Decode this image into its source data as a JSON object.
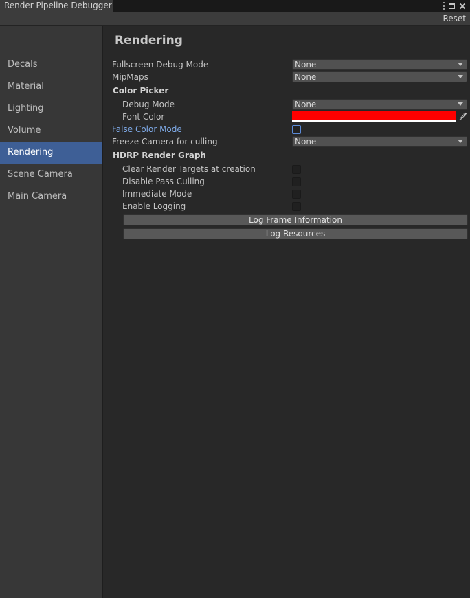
{
  "window": {
    "tab_title": "Render Pipeline Debugger"
  },
  "toolbar": {
    "reset_label": "Reset"
  },
  "sidebar": {
    "items": [
      {
        "label": "Decals",
        "active": false
      },
      {
        "label": "Material",
        "active": false
      },
      {
        "label": "Lighting",
        "active": false
      },
      {
        "label": "Volume",
        "active": false
      },
      {
        "label": "Rendering",
        "active": true
      },
      {
        "label": "Scene Camera",
        "active": false
      },
      {
        "label": "Main Camera",
        "active": false
      }
    ]
  },
  "panel": {
    "title": "Rendering",
    "fullscreen_debug_mode": {
      "label": "Fullscreen Debug Mode",
      "value": "None"
    },
    "mipmaps": {
      "label": "MipMaps",
      "value": "None"
    },
    "color_picker": {
      "header": "Color Picker",
      "debug_mode": {
        "label": "Debug Mode",
        "value": "None"
      },
      "font_color": {
        "label": "Font Color",
        "color": "#ff0000"
      }
    },
    "false_color_mode": {
      "label": "False Color Mode",
      "checked": false
    },
    "freeze_camera": {
      "label": "Freeze Camera for culling",
      "value": "None"
    },
    "render_graph": {
      "header": "HDRP Render Graph",
      "clear_render_targets": {
        "label": "Clear Render Targets at creation",
        "checked": false
      },
      "disable_pass_culling": {
        "label": "Disable Pass Culling",
        "checked": false
      },
      "immediate_mode": {
        "label": "Immediate Mode",
        "checked": false
      },
      "enable_logging": {
        "label": "Enable Logging",
        "checked": false
      },
      "log_frame_info_label": "Log Frame Information",
      "log_resources_label": "Log Resources"
    }
  },
  "colors": {
    "accent": "#3e5f96",
    "highlight_label": "#7da8e5"
  }
}
